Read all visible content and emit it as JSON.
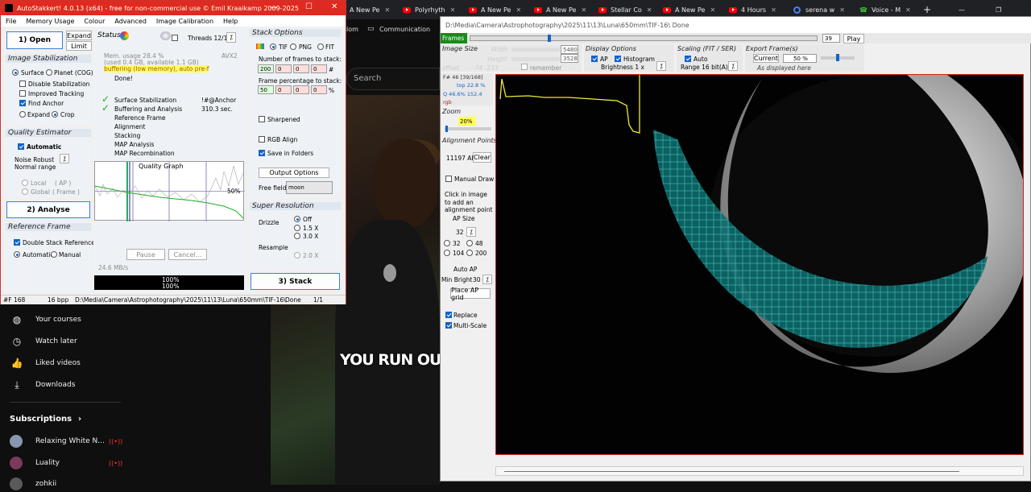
{
  "browser": {
    "tabs": [
      "A New Pe",
      "Polyrhyth",
      "A New Pe",
      "A New Pe",
      "Stellar Co",
      "A New Pe",
      "4 Hours",
      "serena w",
      "Voice - M"
    ]
  },
  "youtube": {
    "sidebar": [
      "Your courses",
      "Watch later",
      "Liked videos",
      "Downloads"
    ],
    "subs_title": "Subscriptions",
    "subs": [
      "Relaxing White N...",
      "Luality",
      "zohkii"
    ],
    "bookmark": "Communication",
    "prefix": "lom",
    "search": "Search",
    "caption": "YOU RUN OUT THE"
  },
  "as": {
    "title": "AutoStakkert! 4.0.13 (x64) - free for non-commercial use © Emil Kraaikamp 2009-2025",
    "menu": [
      "File",
      "Memory Usage",
      "Colour",
      "Advanced",
      "Image Calibration",
      "Help"
    ],
    "open": "1) Open",
    "expand": "Expand",
    "limit": "Limit",
    "image_stab": "Image Stabilization",
    "surface": "Surface",
    "planet": "Planet (COG)",
    "disable_stab": "Disable Stabilization",
    "improved": "Improved Tracking",
    "find_anchor": "Find Anchor",
    "expand_opt": "Expand",
    "crop": "Crop",
    "quality_est": "Quality Estimator",
    "automatic": "Automatic",
    "noise": "Noise Robust",
    "normal_range": "Normal range",
    "local": "Local",
    "local_ap": "( AP )",
    "global": "Global",
    "global_frame": "( Frame )",
    "analyse": "2) Analyse",
    "ref_frame": "Reference Frame",
    "double_stack": "Double Stack Reference",
    "auto": "Automatic",
    "manual": "Manual",
    "status": "Status",
    "threads": "Threads 12/12",
    "mem1": "Mem. usage 28.4 %",
    "mem2": "(used 0.4 GB, available 1.1 GB)",
    "avx": "AVX2",
    "buffering": "buffering (low memory), auto pre-f",
    "done": "Done!",
    "steps": [
      "Surface Stabilization",
      "Buffering and Analysis",
      "Reference Frame",
      "Alignment",
      "Stacking",
      "MAP Analysis",
      "MAP Recombination"
    ],
    "anchor": "!#@Anchor",
    "sec": "310.3 sec.",
    "qgraph": "Quality Graph",
    "pct50": "50%",
    "pause": "Pause",
    "cancel": "Cancel...",
    "rate": "24.6 MB/s",
    "prog1": "100%",
    "prog2": "100%",
    "stack_opts": "Stack Options",
    "tif": "TIF",
    "png": "PNG",
    "fit": "FIT",
    "nframes": "Number of frames to stack:",
    "f1": "200",
    "f0": "0",
    "hash": "#",
    "fpct": "Frame percentage to stack:",
    "p1": "50",
    "pc": "%",
    "sharpened": "Sharpened",
    "rgb_align": "RGB Align",
    "save_folders": "Save in Folders",
    "output_opts": "Output Options",
    "free_field": "Free field",
    "moon": "moon",
    "super_res": "Super Resolution",
    "drizzle": "Drizzle",
    "off": "Off",
    "d15": "1.5 X",
    "d30": "3.0 X",
    "resample": "Resample",
    "r20": "2.0 X",
    "stack": "3) Stack",
    "status_bar": {
      "frame": "#F 168",
      "bpp": "16 bpp",
      "path": "D:\\Media\\Camera\\Astrophotography\\2025\\11\\13\\Luna\\650mm\\TIF-16\\",
      "state": "Done",
      "page": "1/1"
    }
  },
  "rw": {
    "title": "D:\\Media\\Camera\\Astrophotography\\2025\\11\\13\\Luna\\650mm\\TIF-16\\  Done",
    "frames": "Frames",
    "frame_num": "39",
    "play": "Play",
    "image_size": "Image Size",
    "width_lbl": "Width",
    "height_lbl": "Height",
    "width": "5480",
    "height": "3528",
    "offset": "offset",
    "offset_val": "-74 -233",
    "remember": "remember",
    "display_opts": "Display Options",
    "ap": "AP",
    "histogram": "Histogram",
    "brightness": "Brightness 1 x",
    "scaling": "Scaling (FIT / SER)",
    "auto": "Auto",
    "range": "Range 16 bit(A)",
    "export": "Export Frame(s)",
    "current": "Current",
    "pct": "50 %",
    "as_displayed": "As displayed here",
    "finfo1": "F# 46 [39/168]",
    "finfo2": "top 22.8 %",
    "finfo3": "Q 46.6%  152.4",
    "finfo4": "rgb",
    "zoom": "Zoom",
    "zoom_val": "20%",
    "ap_title": "Alignment Points",
    "ap_count": "11197 APs",
    "clear": "Clear",
    "manual_draw": "Manual Draw",
    "click_info": "Click in image to add an alignment point",
    "ap_size": "AP Size",
    "ap_size_val": "32",
    "sizes": [
      "32",
      "48",
      "104",
      "200"
    ],
    "auto_ap": "Auto AP",
    "min_bright": "Min Bright",
    "min_bright_val": "30",
    "place_grid": "Place AP grid",
    "replace": "Replace",
    "multiscale": "Multi-Scale"
  }
}
